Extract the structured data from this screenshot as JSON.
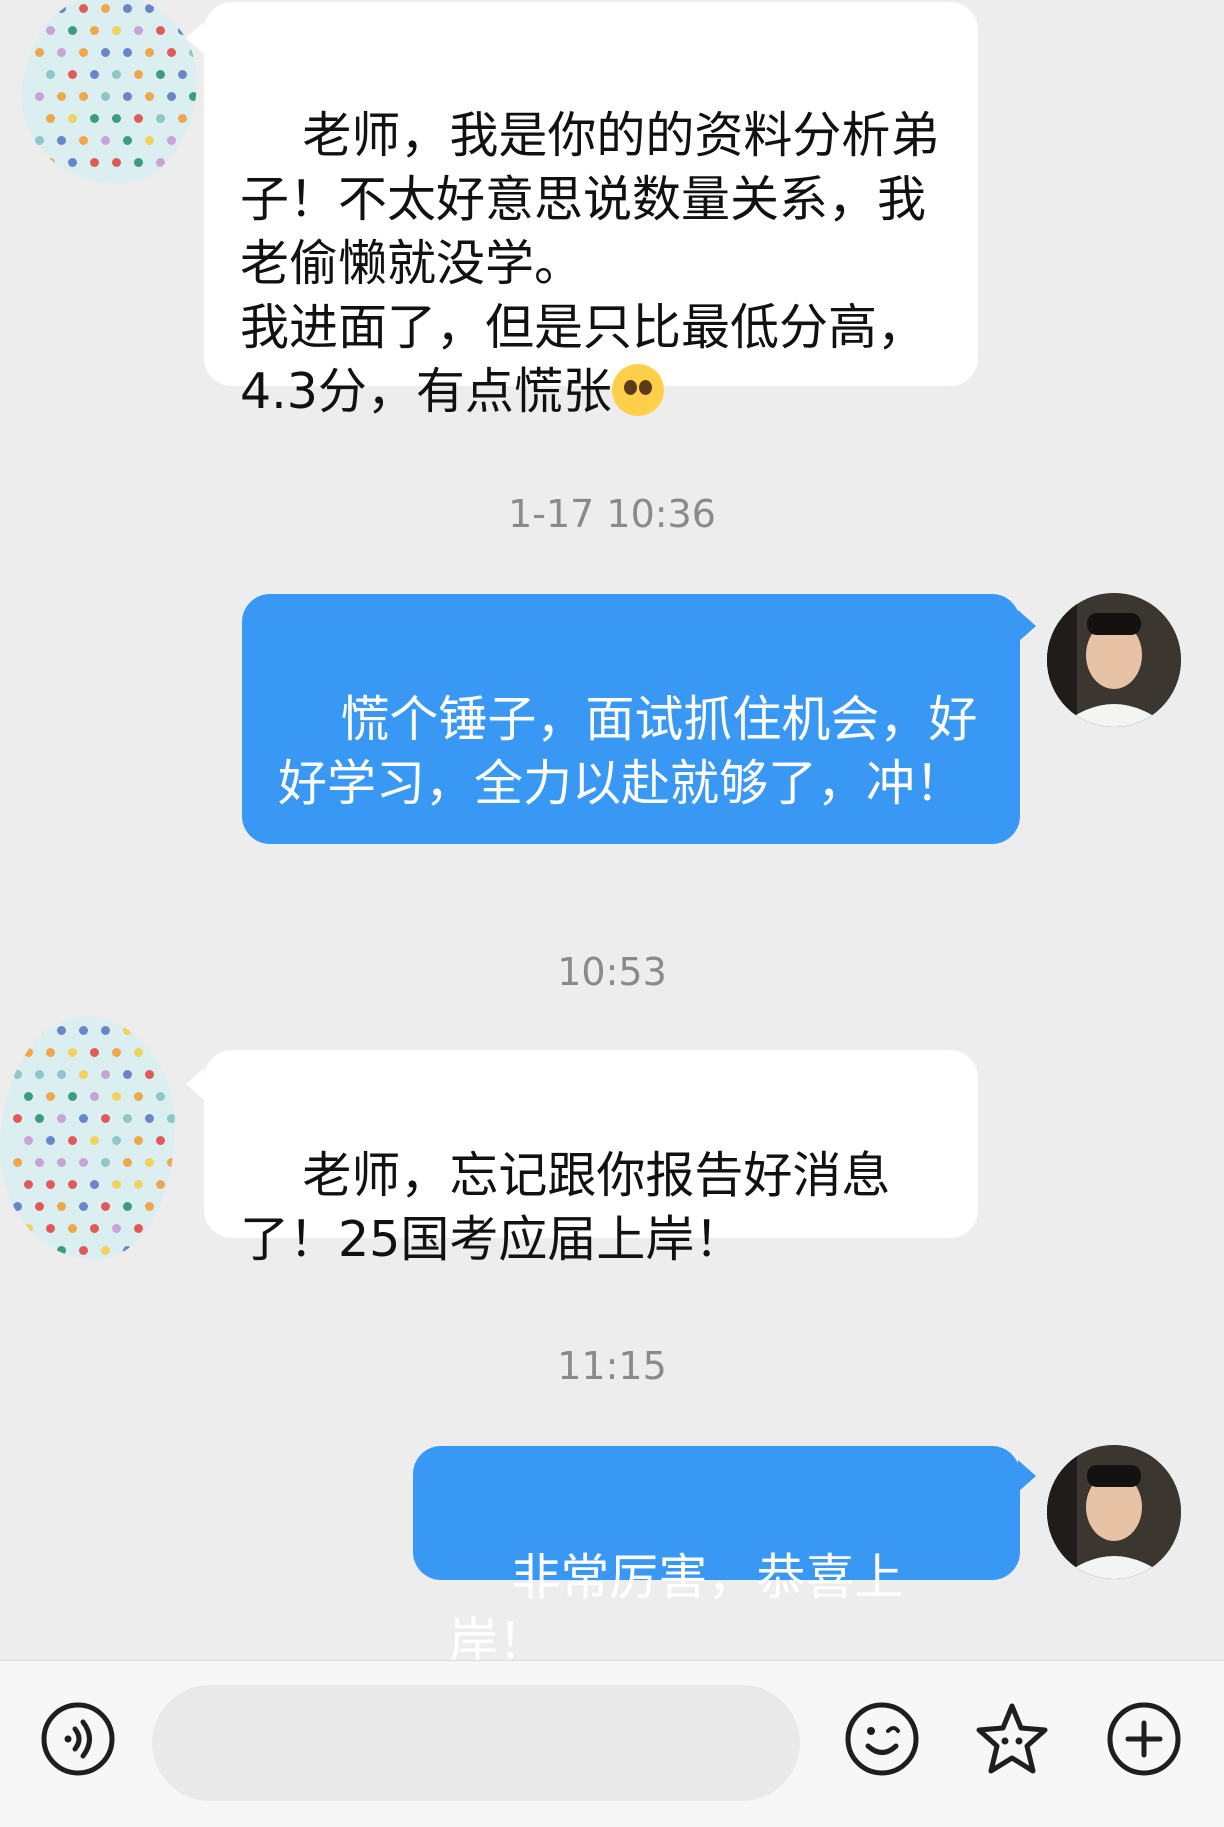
{
  "messages": [
    {
      "side": "left",
      "text": "老师，我是你的的资料分析弟子！不太好意思说数量关系，我老偷懒就没学。\n我进面了，但是只比最低分高，4.3分，有点慌张",
      "emoji": "pleading-face"
    },
    {
      "time": "1-17 10:36"
    },
    {
      "side": "right",
      "text": "慌个锤子，面试抓住机会，好好学习，全力以赴就够了，冲！"
    },
    {
      "time": "10:53"
    },
    {
      "side": "left",
      "text": "老师，忘记跟你报告好消息了！25国考应届上岸！"
    },
    {
      "time": "11:15"
    },
    {
      "side": "right",
      "text": "非常厉害，恭喜上岸！"
    }
  ],
  "toolbar": {
    "voice_icon": "voice-icon",
    "emoji_icon": "smiley-icon",
    "sticker_icon": "star-sticker-icon",
    "more_icon": "plus-icon",
    "input_value": ""
  },
  "colors": {
    "background": "#ededed",
    "self_bubble": "#3a98f5",
    "other_bubble": "#ffffff",
    "timestamp": "#8a8a8a"
  }
}
